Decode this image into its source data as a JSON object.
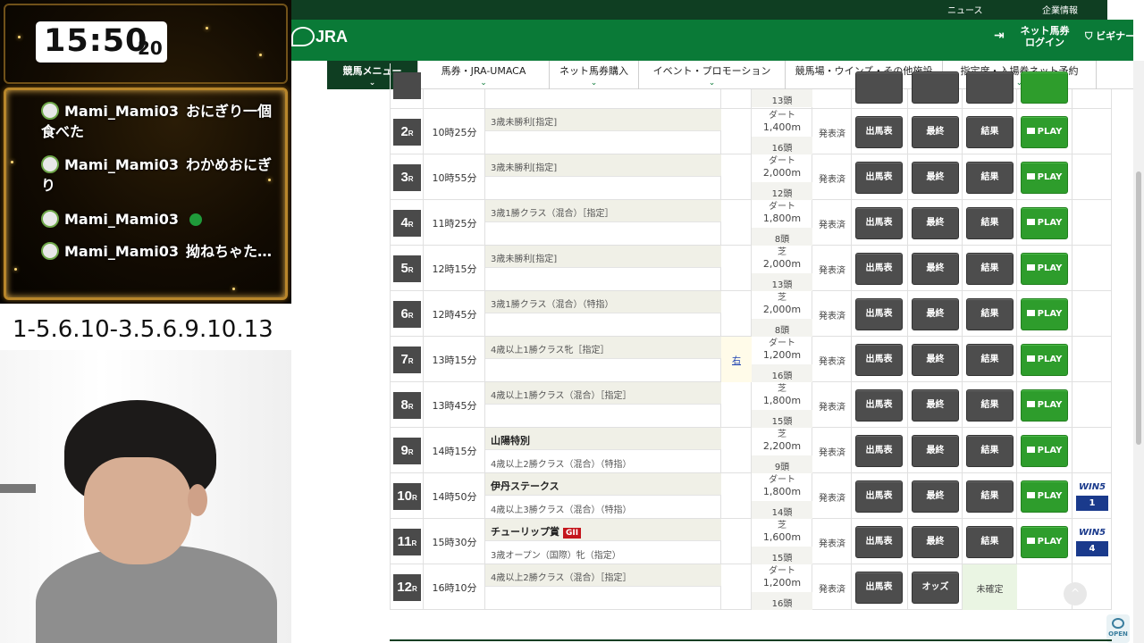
{
  "stream": {
    "clock": {
      "hm": "15:50",
      "sec": "20"
    },
    "chat": [
      {
        "user": "Mami_Mami03",
        "text": "おにぎり一個食べた"
      },
      {
        "user": "Mami_Mami03",
        "text": "わかめおにぎり"
      },
      {
        "user": "Mami_Mami03",
        "text": ""
      },
      {
        "user": "Mami_Mami03",
        "text": "拗ねちゃた…"
      }
    ],
    "memo": "1-5.6.10-3.5.6.9.10.13"
  },
  "site": {
    "topbar": {
      "news": "ニュース",
      "corp": "企業情報"
    },
    "logo": "JRA",
    "login_line1": "ネット馬券",
    "login_line2": "ログイン",
    "beginner": "ビギナー",
    "nav": [
      "競馬メニュー",
      "馬券・JRA-UMACA",
      "ネット馬券購入",
      "イベント・プロモーション",
      "競馬場・ウインズ・その他施設",
      "指定席・入場券ネット予約"
    ],
    "colors": {
      "brand_green": "#0a7a37",
      "dark_green": "#0f3e22",
      "play_green": "#2e9d2c",
      "button_gray": "#4d4d4d"
    },
    "buttons": {
      "shutsuba": "出馬表",
      "saishu": "最終",
      "kekka": "結果",
      "play": "PLAY",
      "odds": "オッズ",
      "unconfirmed": "未確定"
    },
    "top_partial": {
      "heads": "13頭"
    },
    "races": [
      {
        "no": "2",
        "time": "10時25分",
        "name1": "3歳未勝利[指定]",
        "name2": "",
        "surface": "ダート",
        "dist": "1,400m",
        "heads": "16頭",
        "status": "発表済",
        "migi": "",
        "win5": ""
      },
      {
        "no": "3",
        "time": "10時55分",
        "name1": "3歳未勝利[指定]",
        "name2": "",
        "surface": "ダート",
        "dist": "2,000m",
        "heads": "12頭",
        "status": "発表済",
        "migi": "",
        "win5": ""
      },
      {
        "no": "4",
        "time": "11時25分",
        "name1": "3歳1勝クラス（混合）［指定］",
        "name2": "",
        "surface": "ダート",
        "dist": "1,800m",
        "heads": "8頭",
        "status": "発表済",
        "migi": "",
        "win5": ""
      },
      {
        "no": "5",
        "time": "12時15分",
        "name1": "3歳未勝利[指定]",
        "name2": "",
        "surface": "芝",
        "dist": "2,000m",
        "heads": "13頭",
        "status": "発表済",
        "migi": "",
        "win5": ""
      },
      {
        "no": "6",
        "time": "12時45分",
        "name1": "3歳1勝クラス（混合）（特指）",
        "name2": "",
        "surface": "芝",
        "dist": "2,000m",
        "heads": "8頭",
        "status": "発表済",
        "migi": "",
        "win5": ""
      },
      {
        "no": "7",
        "time": "13時15分",
        "name1": "4歳以上1勝クラス牝［指定］",
        "name2": "",
        "surface": "ダート",
        "dist": "1,200m",
        "heads": "16頭",
        "status": "発表済",
        "migi": "右",
        "win5": ""
      },
      {
        "no": "8",
        "time": "13時45分",
        "name1": "4歳以上1勝クラス（混合）［指定］",
        "name2": "",
        "surface": "芝",
        "dist": "1,800m",
        "heads": "15頭",
        "status": "発表済",
        "migi": "",
        "win5": ""
      },
      {
        "no": "9",
        "time": "14時15分",
        "name1": "山陽特別",
        "name2": "4歳以上2勝クラス（混合）（特指）",
        "surface": "芝",
        "dist": "2,200m",
        "heads": "9頭",
        "status": "発表済",
        "migi": "",
        "win5": ""
      },
      {
        "no": "10",
        "time": "14時50分",
        "name1": "伊丹ステークス",
        "name2": "4歳以上3勝クラス（混合）（特指）",
        "surface": "ダート",
        "dist": "1,800m",
        "heads": "14頭",
        "status": "発表済",
        "migi": "",
        "win5": "1"
      },
      {
        "no": "11",
        "time": "15時30分",
        "name1": "チューリップ賞",
        "grade": "GII",
        "name2": "3歳オープン（国際）牝（指定）",
        "surface": "芝",
        "dist": "1,600m",
        "heads": "15頭",
        "status": "発表済",
        "migi": "",
        "win5": "4"
      },
      {
        "no": "12",
        "time": "16時10分",
        "name1": "4歳以上2勝クラス（混合）［指定］",
        "name2": "",
        "surface": "ダート",
        "dist": "1,200m",
        "heads": "16頭",
        "status": "発表済",
        "migi": "",
        "win5": "",
        "pending": true
      }
    ],
    "win5_label": "WIN5",
    "race_suffix": "R",
    "open_badge": "OPEN"
  }
}
